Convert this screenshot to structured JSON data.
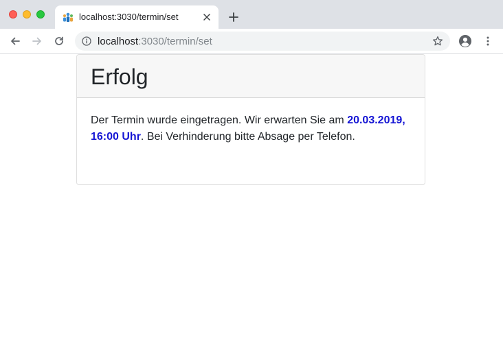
{
  "browser": {
    "tab_title": "localhost:3030/termin/set",
    "url_host": "localhost",
    "url_rest": ":3030/termin/set"
  },
  "icons": {
    "favicon": "people-group-icon",
    "tab_close": "close-icon",
    "new_tab": "plus-icon",
    "back": "arrow-left-icon",
    "forward": "arrow-right-icon",
    "reload": "reload-icon",
    "site_info": "info-icon",
    "bookmark": "star-icon",
    "profile": "account-circle-icon",
    "menu": "kebab-menu-icon"
  },
  "colors": {
    "traffic_close": "#ff5f57",
    "traffic_min": "#febc2e",
    "traffic_max": "#28c840",
    "highlight_date": "#1515d4"
  },
  "card": {
    "title": "Erfolg",
    "text_before": "Der Termin wurde eingetragen. Wir erwarten Sie am ",
    "date_time": "20.03.2019, 16:00 Uhr",
    "text_after": ". Bei Verhinderung bitte Absage per Telefon."
  }
}
